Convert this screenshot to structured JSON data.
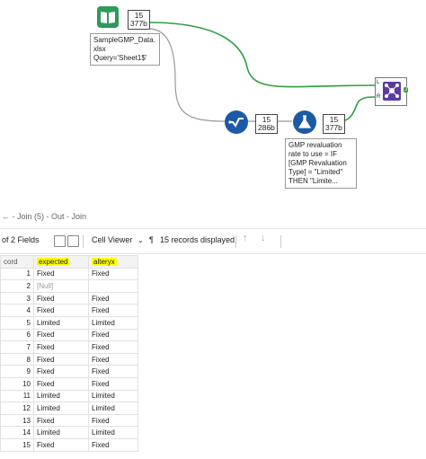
{
  "canvas": {
    "input_tool": {
      "records": "15",
      "size": "377b",
      "annotation": "SampleGMP_Data.\nxlsx\nQuery='Sheet1$'"
    },
    "select_tool": {
      "records": "15",
      "size": "286b"
    },
    "formula_tool": {
      "records": "15",
      "size": "377b",
      "annotation": "GMP revaluation\nrate to use = IF\n[GMP Revaluation\nType] = \"Limited\"\nTHEN \"Limite...",
      "color": "#1d5aa6"
    },
    "join_tool": {
      "anchor_l": "L",
      "anchor_r": "R",
      "anchor_j": "J",
      "color": "#5b3c9e"
    },
    "wire_color": "#2e9e3e"
  },
  "results": {
    "title": "← - Join (5) - Out - Join",
    "fields_label": "of 2 Fields",
    "cell_viewer_label": "Cell Viewer",
    "records_displayed": "15 records displayed",
    "columns": [
      "cord",
      "expected",
      "alteryx"
    ],
    "rows": [
      [
        "1",
        "Fixed",
        "Fixed"
      ],
      [
        "2",
        "[Null]",
        ""
      ],
      [
        "3",
        "Fixed",
        "Fixed"
      ],
      [
        "4",
        "Fixed",
        "Fixed"
      ],
      [
        "5",
        "Limited",
        "Limited"
      ],
      [
        "6",
        "Fixed",
        "Fixed"
      ],
      [
        "7",
        "Fixed",
        "Fixed"
      ],
      [
        "8",
        "Fixed",
        "Fixed"
      ],
      [
        "9",
        "Fixed",
        "Fixed"
      ],
      [
        "10",
        "Fixed",
        "Fixed"
      ],
      [
        "11",
        "Limited",
        "Limited"
      ],
      [
        "12",
        "Limited",
        "Limited"
      ],
      [
        "13",
        "Fixed",
        "Fixed"
      ],
      [
        "14",
        "Limited",
        "Limited"
      ],
      [
        "15",
        "Fixed",
        "Fixed"
      ]
    ],
    "highlight_color": "#ffff00"
  }
}
